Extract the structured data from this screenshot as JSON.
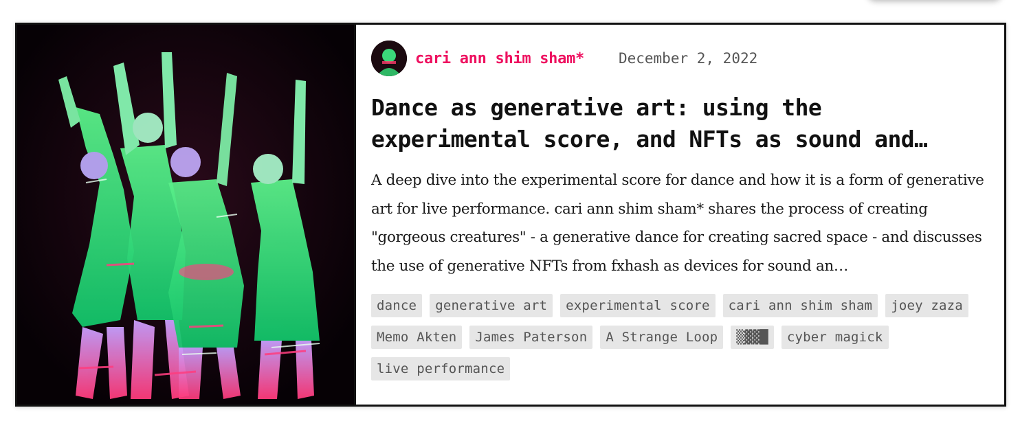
{
  "post": {
    "author": "cari ann shim sham*",
    "date": "December 2, 2022",
    "title": "Dance as generative art: using the experimental score, and NFTs as sound and…",
    "description": "A deep dive into the experimental score for dance and how it is a form of generative art for live performance. cari ann shim sham* shares the process of creating \"gorgeous creatures\" - a generative dance for creating sacred space - and discusses the use of generative NFTs from fxhash as devices for sound an…",
    "tags": [
      "dance",
      "generative art",
      "experimental score",
      "cari ann shim sham",
      "joey zaza",
      "Memo Akten",
      "James Paterson",
      "A Strange Loop",
      "▒▓▓█",
      "cyber magick",
      "live performance"
    ],
    "image_icon": "dancers-photo",
    "avatar_icon": "author-avatar"
  },
  "colors": {
    "author": "#ee1160",
    "tag_background": "#e6e6e6",
    "border": "#111111"
  }
}
